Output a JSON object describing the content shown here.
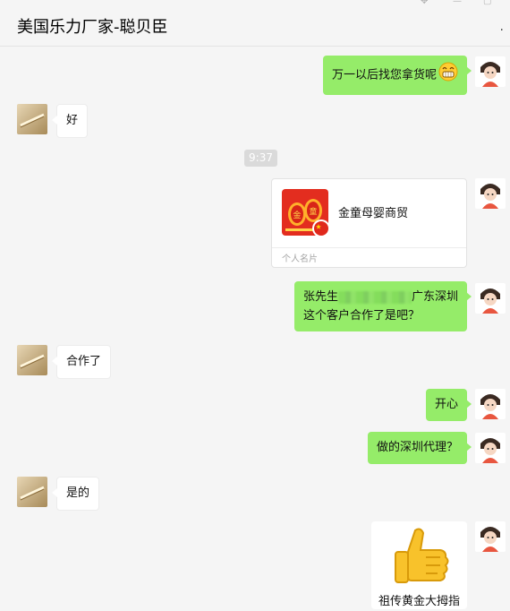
{
  "window": {
    "title": "美国乐力厂家-聪贝臣",
    "more_label": ".",
    "controls": [
      "pin-icon",
      "minimize-icon",
      "close-icon"
    ]
  },
  "messages": [
    {
      "side": "right",
      "kind": "text",
      "text": "万一以后找您拿货呢",
      "emoji": "grin-face-icon"
    },
    {
      "side": "left",
      "kind": "text",
      "text": "好"
    },
    {
      "kind": "time",
      "text": "9:37"
    },
    {
      "side": "right",
      "kind": "card",
      "name": "金童母婴商贸",
      "type_label": "个人名片"
    },
    {
      "side": "right",
      "kind": "text",
      "line1_prefix": "张先生",
      "line1_suffix": "广东深圳",
      "line2": "这个客户合作了是吧？",
      "redacted": true
    },
    {
      "side": "left",
      "kind": "text",
      "text": "合作了"
    },
    {
      "side": "right",
      "kind": "text",
      "text": "开心"
    },
    {
      "side": "right",
      "kind": "text",
      "text": "做的深圳代理？"
    },
    {
      "side": "left",
      "kind": "text",
      "text": "是的"
    },
    {
      "side": "right",
      "kind": "sticker",
      "caption": "祖传黄金大拇指",
      "icon": "thumbs-up-icon"
    }
  ],
  "colors": {
    "sent_bubble": "#95ec69",
    "received_bubble": "#ffffff",
    "background": "#f5f5f5",
    "time_badge": "#dadada"
  }
}
